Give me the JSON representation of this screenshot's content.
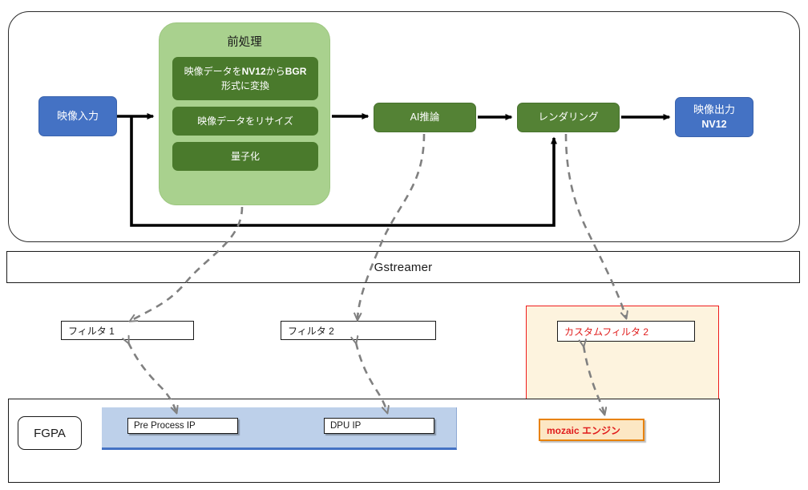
{
  "diagram": {
    "title": "Gstreamer FPGA video pipeline",
    "colors": {
      "blue_node": "#4472C4",
      "green_node": "#548235",
      "green_sub": "#4A7A2C",
      "green_group": "#A9D18E",
      "fpga_panel": "#BDD0EA",
      "custom_region_fill": "#FDF3DE",
      "custom_region_border": "#EE1C1C",
      "mozaic_fill": "#FCE7C4",
      "mozaic_border": "#E8820C",
      "red_text": "#E01B1B",
      "connector_dashed": "#808080",
      "connector_solid": "#000000"
    }
  },
  "pipeline": {
    "video_input": {
      "label": "映像入力"
    },
    "preprocess": {
      "title": "前処理",
      "steps": [
        {
          "label_pre": "映像データを",
          "label_bold": "NV12",
          "label_mid": "から",
          "label_bold2": "BGR",
          "label_post": "形式に変換",
          "full": "映像データをNV12からBGR形式に変換"
        },
        {
          "full": "映像データをリサイズ"
        },
        {
          "full": "量子化"
        }
      ]
    },
    "ai_inference": {
      "label": "AI推論"
    },
    "rendering": {
      "label": "レンダリング"
    },
    "video_output": {
      "label_line1": "映像出力",
      "label_line2": "NV12"
    }
  },
  "gstreamer": {
    "label": "Gstreamer"
  },
  "filters": [
    {
      "label": "フィルタ 1"
    },
    {
      "label": "フィルタ 2"
    },
    {
      "label": "カスタムフィルタ 2"
    }
  ],
  "fpga": {
    "badge": "FGPA",
    "ip_blocks": [
      {
        "label": "Pre Process IP"
      },
      {
        "label": "DPU IP"
      }
    ]
  },
  "custom_region": {
    "engine": {
      "label": "mozaic エンジン"
    }
  }
}
